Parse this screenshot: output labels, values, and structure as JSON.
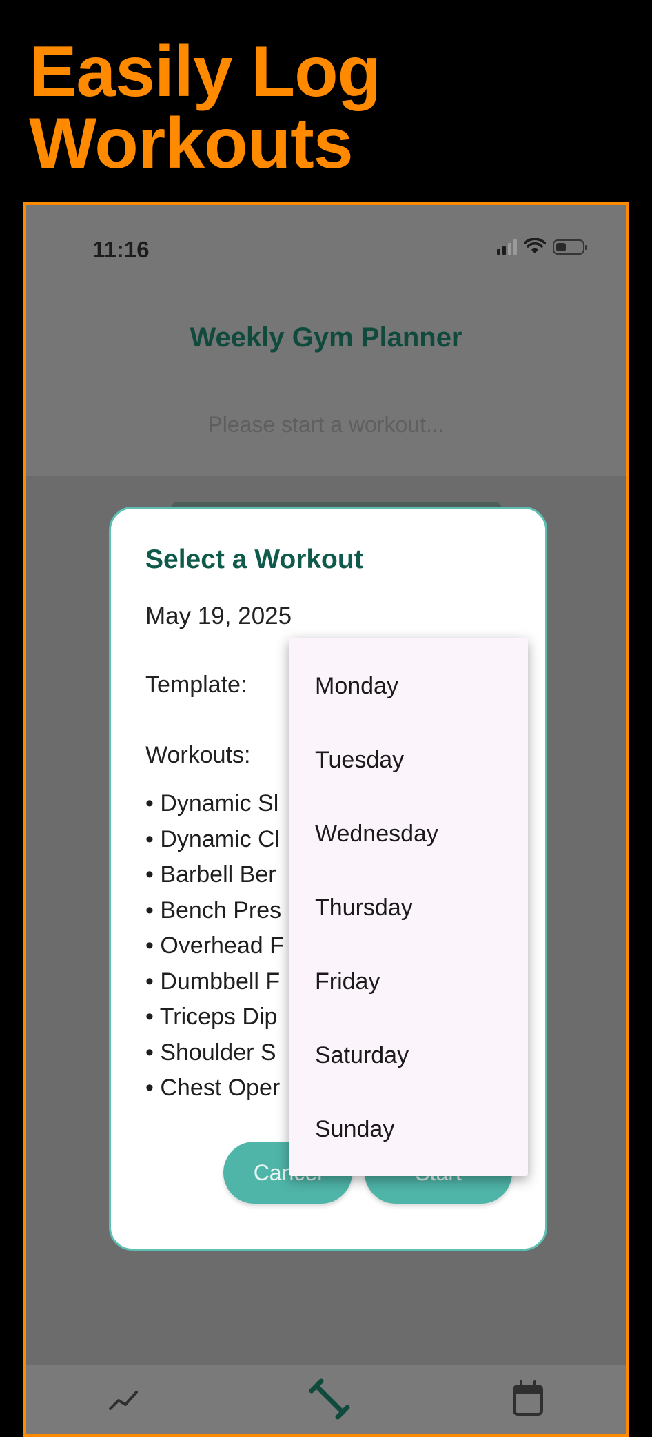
{
  "promo": {
    "title_line1": "Easily Log",
    "title_line2": "Workouts",
    "accent_color": "#ff8a00"
  },
  "status_bar": {
    "time": "11:16",
    "icons": [
      "signal-icon",
      "wifi-icon",
      "battery-icon"
    ]
  },
  "app": {
    "title": "Weekly Gym Planner",
    "hint": "Please start a workout..."
  },
  "modal": {
    "title": "Select a Workout",
    "date": "May 19, 2025",
    "template_label": "Template:",
    "workouts_label": "Workouts:",
    "workouts": [
      "• Dynamic Sl",
      "• Dynamic Cl",
      "• Barbell Ber",
      "• Bench Pres",
      "• Overhead F",
      "• Dumbbell F",
      "• Triceps Dip",
      "• Shoulder S",
      "• Chest Oper"
    ],
    "cancel_label": "Cancel",
    "start_label": "Start",
    "accent_color": "#4fb5a8"
  },
  "dropdown": {
    "options": [
      "Monday",
      "Tuesday",
      "Wednesday",
      "Thursday",
      "Friday",
      "Saturday",
      "Sunday"
    ]
  },
  "bottom_nav": {
    "items": [
      "stats-icon",
      "dumbbell-icon",
      "calendar-icon"
    ]
  }
}
